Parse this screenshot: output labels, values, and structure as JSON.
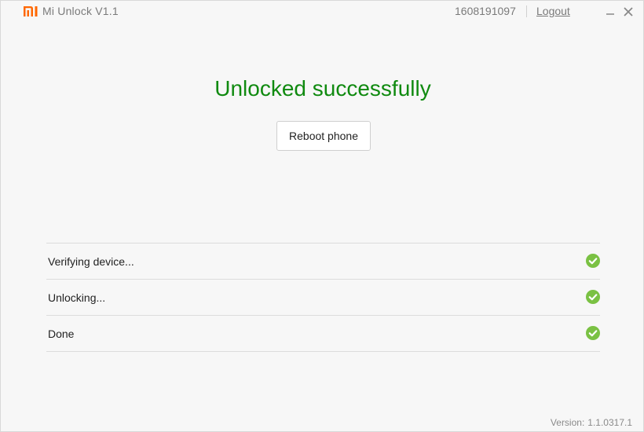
{
  "app": {
    "logo_text": "MI",
    "name": "Mi Unlock",
    "version": "V1.1",
    "brand_color": "#ff6700"
  },
  "account": {
    "id": "1608191097",
    "logout_label": "Logout"
  },
  "window_controls": {
    "minimize_icon": "minimize-icon",
    "close_icon": "close-icon"
  },
  "main": {
    "headline": "Unlocked successfully",
    "headline_color": "#108a10",
    "reboot_label": "Reboot phone"
  },
  "steps": [
    {
      "label": "Verifying device...",
      "status": "done",
      "icon": "check-circle-icon"
    },
    {
      "label": "Unlocking...",
      "status": "done",
      "icon": "check-circle-icon"
    },
    {
      "label": "Done",
      "status": "done",
      "icon": "check-circle-icon"
    }
  ],
  "check_color": "#7ac143",
  "footer": {
    "version_label": "Version:",
    "version_value": "1.1.0317.1"
  }
}
